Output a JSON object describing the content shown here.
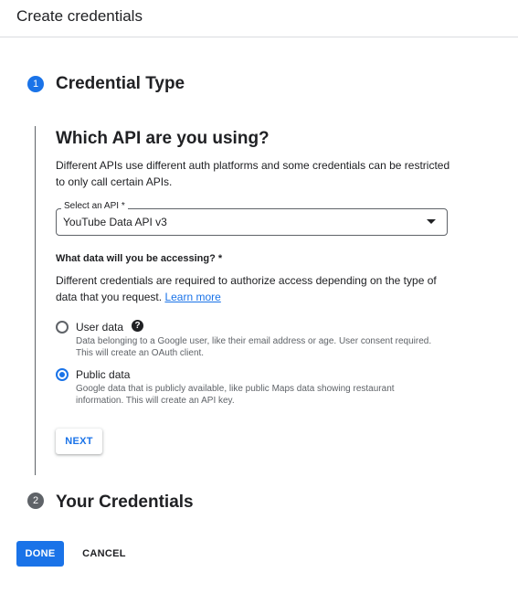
{
  "header": {
    "title": "Create credentials"
  },
  "steps": [
    {
      "number": "1",
      "title": "Credential Type"
    },
    {
      "number": "2",
      "title": "Your Credentials"
    }
  ],
  "step1": {
    "heading": "Which API are you using?",
    "description": "Different APIs use different auth platforms and some credentials can be restricted to only call certain APIs.",
    "api_select": {
      "label": "Select an API *",
      "value": "YouTube Data API v3"
    },
    "question": "What data will you be accessing? *",
    "question_description": "Different credentials are required to authorize access depending on the type of data that you request.",
    "learn_more": "Learn more",
    "options": [
      {
        "label": "User data",
        "description": "Data belonging to a Google user, like their email address or age. User consent required. This will create an OAuth client.",
        "selected": false
      },
      {
        "label": "Public data",
        "description": "Google data that is publicly available, like public Maps data showing restaurant information. This will create an API key.",
        "selected": true
      }
    ],
    "help_icon": "?",
    "next_label": "NEXT"
  },
  "footer": {
    "done_label": "DONE",
    "cancel_label": "CANCEL"
  },
  "colors": {
    "accent": "#1a73e8",
    "inactive_step": "#5f6368"
  }
}
